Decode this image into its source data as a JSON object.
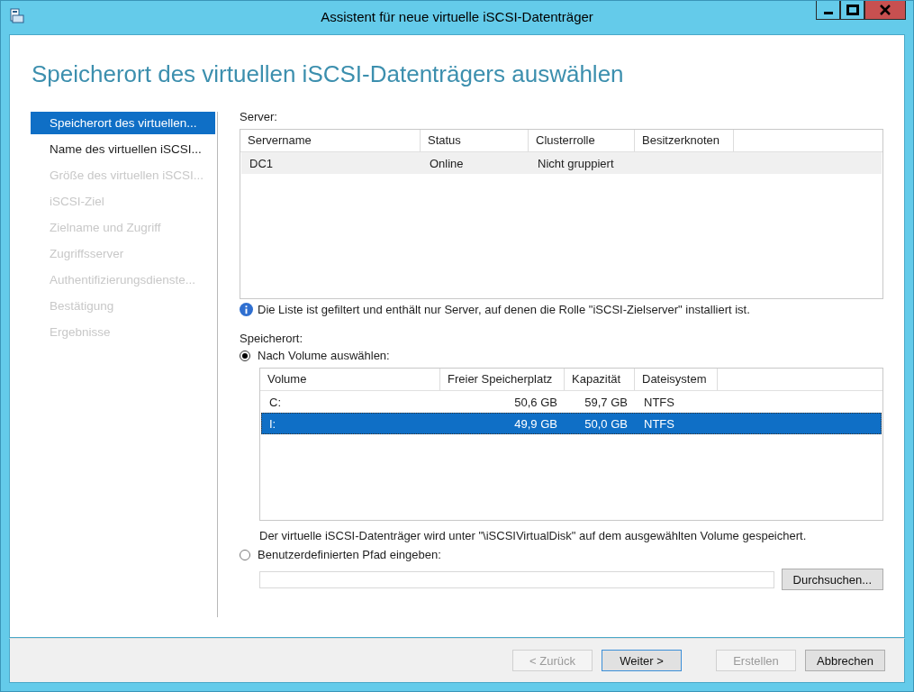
{
  "window": {
    "title": "Assistent für neue virtuelle iSCSI-Datenträger"
  },
  "heading": "Speicherort des virtuellen iSCSI-Datenträgers auswählen",
  "steps": [
    {
      "label": "Speicherort des virtuellen...",
      "selected": true,
      "disabled": false
    },
    {
      "label": "Name des virtuellen iSCSI...",
      "selected": false,
      "disabled": false
    },
    {
      "label": "Größe des virtuellen iSCSI...",
      "selected": false,
      "disabled": true
    },
    {
      "label": "iSCSI-Ziel",
      "selected": false,
      "disabled": true
    },
    {
      "label": "Zielname und Zugriff",
      "selected": false,
      "disabled": true
    },
    {
      "label": "Zugriffsserver",
      "selected": false,
      "disabled": true
    },
    {
      "label": "Authentifizierungsdienste...",
      "selected": false,
      "disabled": true
    },
    {
      "label": "Bestätigung",
      "selected": false,
      "disabled": true
    },
    {
      "label": "Ergebnisse",
      "selected": false,
      "disabled": true
    }
  ],
  "server_label": "Server:",
  "server_table": {
    "focused": false,
    "columns": [
      "Servername",
      "Status",
      "Clusterrolle",
      "Besitzerknoten"
    ],
    "rows": [
      {
        "cells": [
          "DC1",
          "Online",
          "Nicht gruppiert",
          ""
        ],
        "selected": true
      }
    ]
  },
  "info_note": "Die Liste ist gefiltert und enthält nur Server, auf denen die Rolle \"iSCSI-Zielserver\" installiert ist.",
  "location_label": "Speicherort:",
  "options": [
    {
      "label": "Nach Volume auswählen:",
      "selected": true
    },
    {
      "label": "Benutzerdefinierten Pfad eingeben:",
      "selected": false
    }
  ],
  "volume_table": {
    "focused": true,
    "columns": [
      "Volume",
      "Freier Speicherplatz",
      "Kapazität",
      "Dateisystem"
    ],
    "rows": [
      {
        "cells": [
          "C:",
          "50,6 GB",
          "59,7 GB",
          "NTFS"
        ],
        "selected": false
      },
      {
        "cells": [
          "I:",
          "49,9 GB",
          "50,0 GB",
          "NTFS"
        ],
        "selected": true
      }
    ]
  },
  "volume_note": "Der virtuelle iSCSI-Datenträger wird unter \"\\iSCSIVirtualDisk\" auf dem ausgewählten Volume gespeichert.",
  "browse_button": "Durchsuchen...",
  "buttons": [
    {
      "label": "< Zurück",
      "disabled": true,
      "default": false
    },
    {
      "label": "Weiter >",
      "disabled": false,
      "default": true
    },
    {
      "label": "Erstellen",
      "disabled": true,
      "default": false
    },
    {
      "label": "Abbrechen",
      "disabled": false,
      "default": false
    }
  ]
}
